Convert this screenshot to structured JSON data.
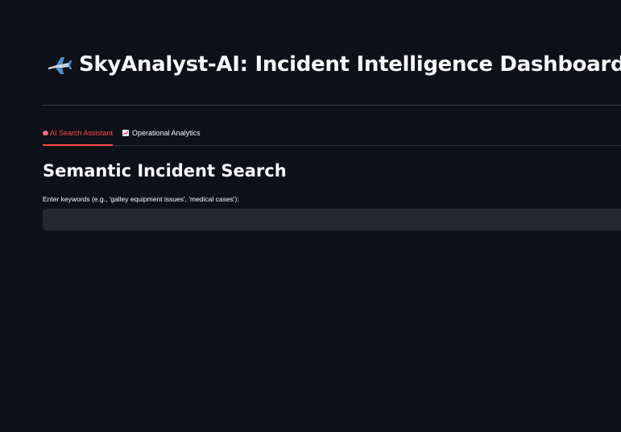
{
  "header": {
    "title": "SkyAnalyst-AI: Incident Intelligence Dashboard",
    "icon": "airplane-icon"
  },
  "tabs": [
    {
      "label": "AI Search Assistant",
      "icon": "brain-icon",
      "active": true
    },
    {
      "label": "Operational Analytics",
      "icon": "chart-increasing-icon",
      "active": false
    }
  ],
  "main": {
    "section_title": "Semantic Incident Search",
    "search": {
      "label": "Enter keywords (e.g., 'galley equipment issues', 'medical cases'):",
      "value": "",
      "placeholder": ""
    }
  },
  "colors": {
    "background": "#0e1117",
    "accent": "#ff4b4b",
    "input_bg": "#262730",
    "text": "#fafafa"
  }
}
